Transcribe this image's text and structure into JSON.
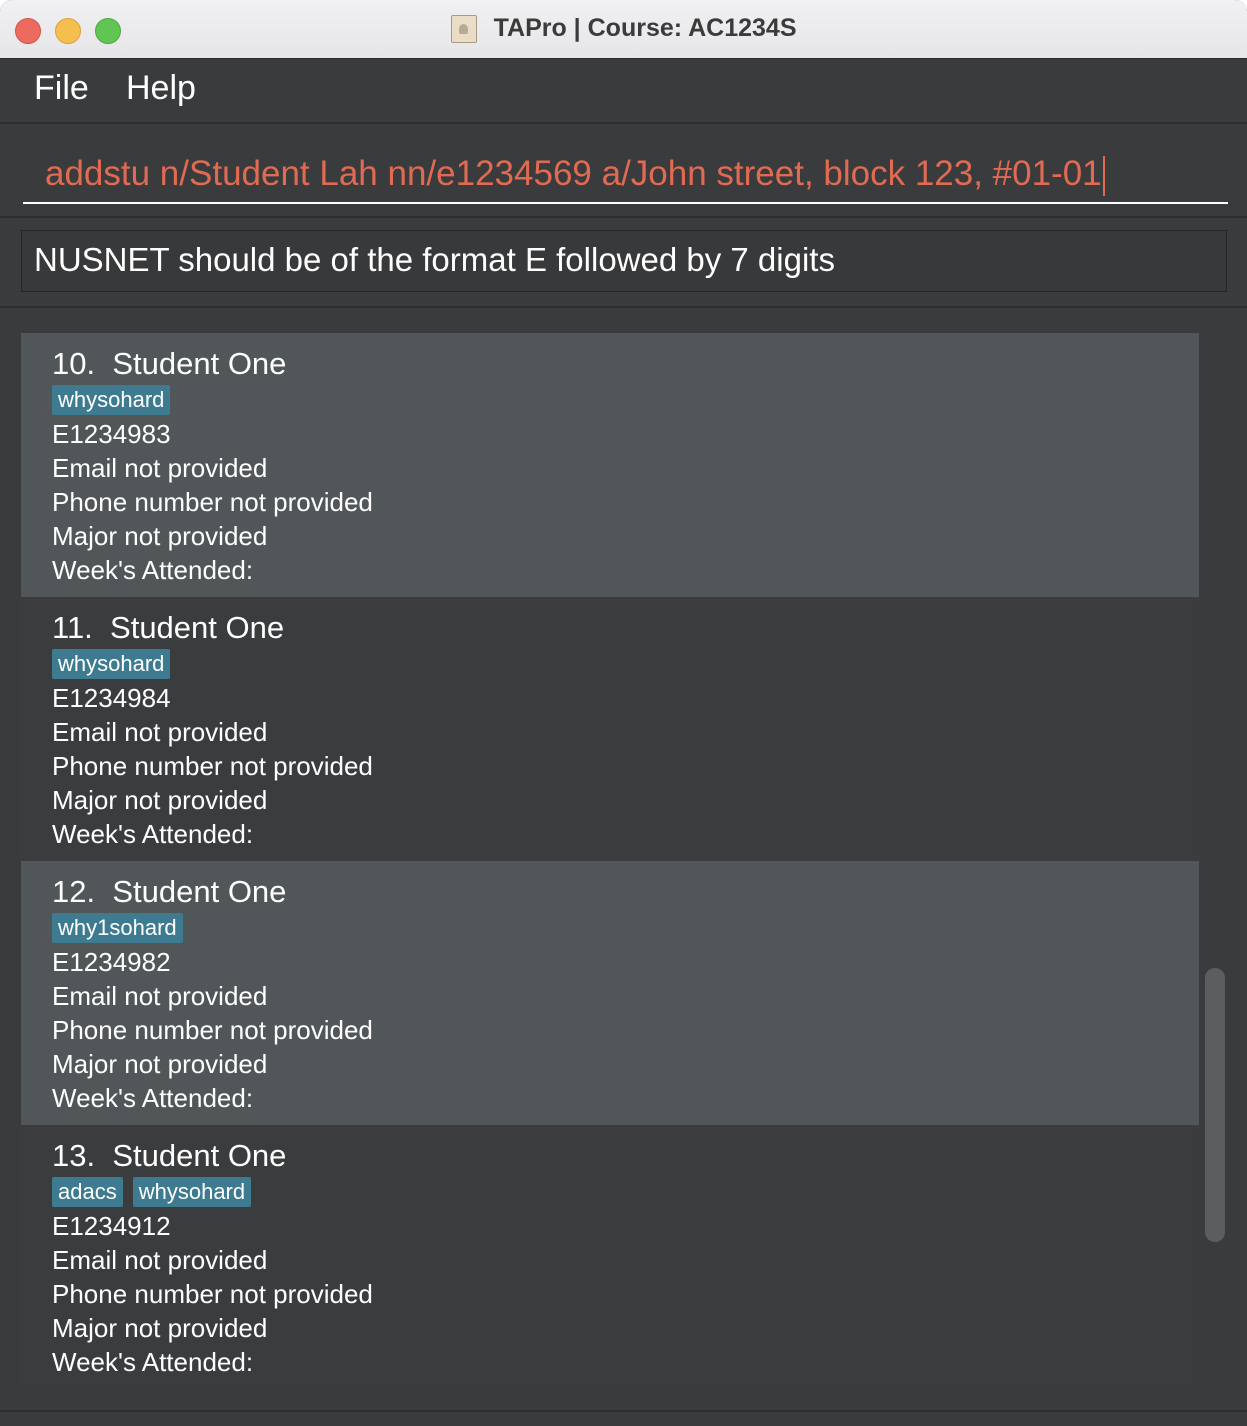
{
  "window": {
    "title": "TAPro | Course: AC1234S"
  },
  "menu": {
    "file": "File",
    "help": "Help"
  },
  "command": {
    "value": "addstu n/Student Lah nn/e1234569 a/John street, block 123, #01-01"
  },
  "result": {
    "message": "NUSNET should be of the format E followed by 7 digits"
  },
  "students": [
    {
      "index": "10.",
      "name": "Student One",
      "tags": [
        "whysohard"
      ],
      "nusnet": "E1234983",
      "email": "Email not provided",
      "phone": "Phone number not provided",
      "major": "Major not provided",
      "attendance": "Week's Attended:"
    },
    {
      "index": "11.",
      "name": "Student One",
      "tags": [
        "whysohard"
      ],
      "nusnet": "E1234984",
      "email": "Email not provided",
      "phone": "Phone number not provided",
      "major": "Major not provided",
      "attendance": "Week's Attended:"
    },
    {
      "index": "12.",
      "name": "Student One",
      "tags": [
        "why1sohard"
      ],
      "nusnet": "E1234982",
      "email": "Email not provided",
      "phone": "Phone number not provided",
      "major": "Major not provided",
      "attendance": "Week's Attended:"
    },
    {
      "index": "13.",
      "name": "Student One",
      "tags": [
        "adacs",
        "whysohard"
      ],
      "nusnet": "E1234912",
      "email": "Email not provided",
      "phone": "Phone number not provided",
      "major": "Major not provided",
      "attendance": "Week's Attended:"
    }
  ],
  "colors": {
    "background": "#3a3b3d",
    "card_alt": "#515658",
    "tag": "#3e7b91",
    "command_text": "#e06a52"
  }
}
